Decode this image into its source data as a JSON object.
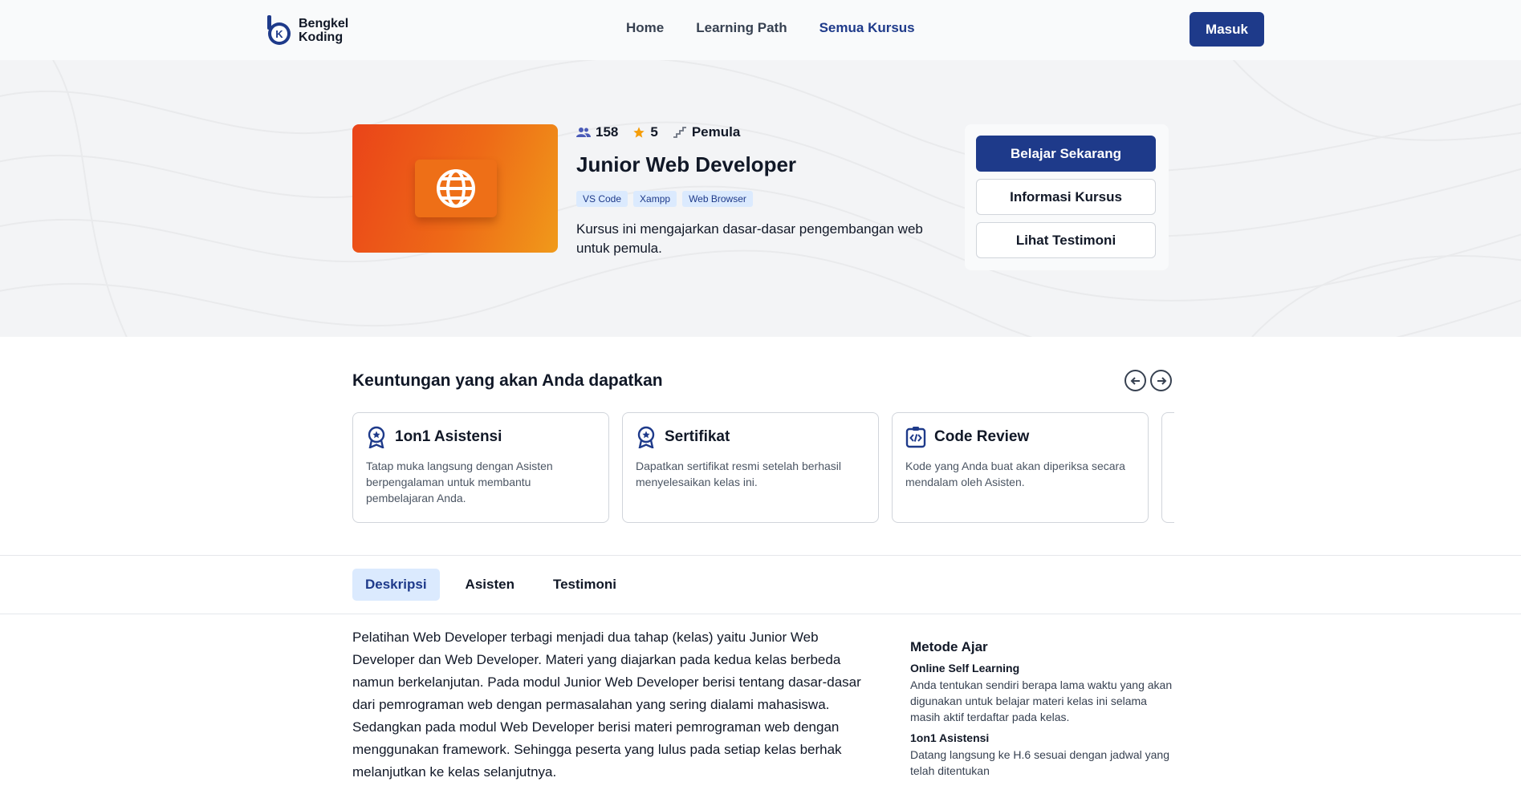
{
  "brand": {
    "line1": "Bengkel",
    "line2": "Koding",
    "mark_letter": "K",
    "color": "#1e3a8a"
  },
  "nav": {
    "items": [
      {
        "label": "Home"
      },
      {
        "label": "Learning Path"
      },
      {
        "label": "Semua Kursus"
      }
    ],
    "login_label": "Masuk"
  },
  "course": {
    "students": "158",
    "rating": "5",
    "level": "Pemula",
    "title": "Junior Web Developer",
    "tags": [
      "VS Code",
      "Xampp",
      "Web Browser"
    ],
    "description": "Kursus ini mengajarkan dasar-dasar pengembangan web untuk pemula.",
    "thumbnail_icon": "globe-icon"
  },
  "actions": {
    "primary": "Belajar Sekarang",
    "info": "Informasi Kursus",
    "testimonials": "Lihat Testimoni"
  },
  "benefits": {
    "title": "Keuntungan yang akan Anda dapatkan",
    "items": [
      {
        "icon": "award-icon",
        "title": "1on1 Asistensi",
        "text": "Tatap muka langsung dengan Asisten berpengalaman untuk membantu pembelajaran Anda."
      },
      {
        "icon": "award-icon",
        "title": "Sertifikat",
        "text": "Dapatkan sertifikat resmi setelah berhasil menyelesaikan kelas ini."
      },
      {
        "icon": "code-review-icon",
        "title": "Code Review",
        "text": "Kode yang Anda buat akan diperiksa secara mendalam oleh Asisten."
      }
    ]
  },
  "tabs": [
    {
      "label": "Deskripsi",
      "active": true
    },
    {
      "label": "Asisten",
      "active": false
    },
    {
      "label": "Testimoni",
      "active": false
    }
  ],
  "description": "Pelatihan Web Developer terbagi menjadi dua tahap (kelas) yaitu Junior Web Developer dan Web Developer. Materi yang diajarkan pada kedua kelas berbeda namun berkelanjutan. Pada modul Junior Web Developer berisi tentang dasar-dasar dari pemrograman web dengan permasalahan yang sering dialami mahasiswa. Sedangkan pada modul Web Developer berisi materi pemrograman web dengan menggunakan framework. Sehingga peserta yang lulus pada setiap kelas berhak melanjutkan ke kelas selanjutnya.",
  "method": {
    "title": "Metode Ajar",
    "items": [
      {
        "title": "Online Self Learning",
        "text": "Anda tentukan sendiri berapa lama waktu yang akan digunakan untuk belajar materi kelas ini selama masih aktif terdaftar pada kelas."
      },
      {
        "title": "1on1 Asistensi",
        "text": "Datang langsung ke H.6 sesuai dengan jadwal yang telah ditentukan"
      }
    ]
  },
  "colors": {
    "primary": "#1e3a8a",
    "tag_bg": "#dbeafe",
    "star": "#f59e0b",
    "thumb_start": "#ea4419",
    "thumb_end": "#f09a1a"
  }
}
